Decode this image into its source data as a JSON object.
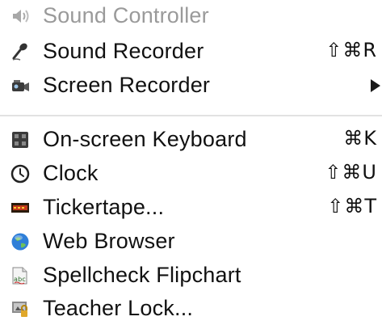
{
  "menu": {
    "items": [
      {
        "label": "Sound Controller",
        "shortcut": "",
        "enabled": false,
        "icon": "speaker-icon"
      },
      {
        "label": "Sound Recorder",
        "shortcut": "⇧⌘R",
        "enabled": true,
        "icon": "microphone-icon"
      },
      {
        "label": "Screen Recorder",
        "shortcut": "",
        "enabled": true,
        "icon": "video-camera-icon",
        "submenu": true
      },
      {
        "label": "On-screen Keyboard",
        "shortcut": "⌘K",
        "enabled": true,
        "icon": "keyboard-icon"
      },
      {
        "label": "Clock",
        "shortcut": "⇧⌘U",
        "enabled": true,
        "icon": "clock-icon"
      },
      {
        "label": "Tickertape...",
        "shortcut": "⇧⌘T",
        "enabled": true,
        "icon": "tickertape-icon"
      },
      {
        "label": "Web Browser",
        "shortcut": "",
        "enabled": true,
        "icon": "globe-icon"
      },
      {
        "label": "Spellcheck Flipchart",
        "shortcut": "",
        "enabled": true,
        "icon": "spellcheck-icon"
      },
      {
        "label": "Teacher Lock...",
        "shortcut": "",
        "enabled": true,
        "icon": "lock-icon"
      }
    ]
  },
  "colors": {
    "text": "#111111",
    "disabled_text": "#9a9a9a",
    "separator": "#e2e2e2",
    "background": "#ffffff"
  }
}
